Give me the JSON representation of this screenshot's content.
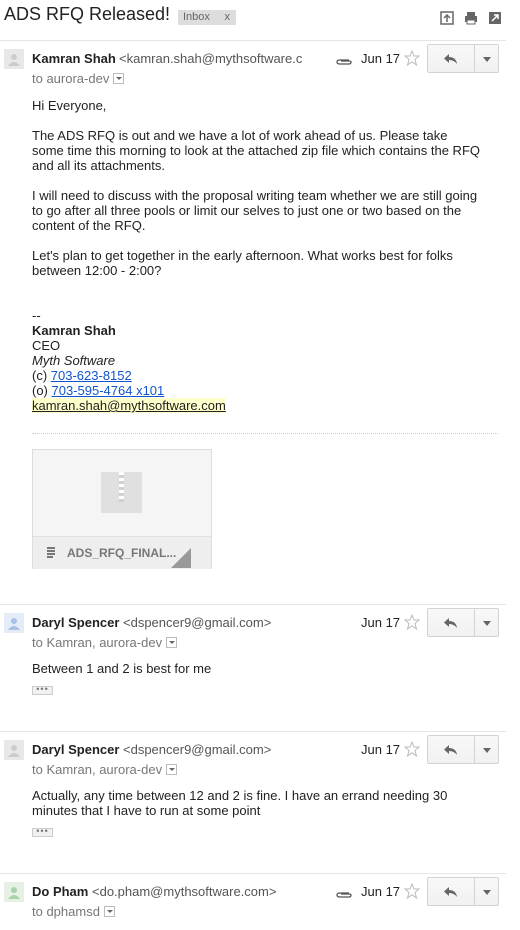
{
  "thread": {
    "subject": "ADS RFQ Released!",
    "label": "Inbox",
    "label_remove": "x"
  },
  "messages": [
    {
      "sender": "Kamran Shah",
      "email": "<kamran.shah@mythsoftware.com>",
      "to": "to aurora-dev",
      "date": "Jun 17",
      "has_attachment": true,
      "body": {
        "greeting": "Hi Everyone,",
        "p1": "The ADS RFQ is out and we have a lot of work ahead of us.  Please take some time this morning to look at the attached zip file which contains the RFQ and all its attachments.",
        "p2": "I will need to discuss with the proposal writing team whether we are still going to go after all three pools or limit our selves to just one or two based on the content of the RFQ.",
        "p3": "Let's plan to get together in the early afternoon.  What works best for folks between 12:00 - 2:00?",
        "sig_dash": "--",
        "sig_name": "Kamran Shah",
        "sig_title": "CEO",
        "sig_company": "Myth Software",
        "sig_cell_prefix": "(c) ",
        "sig_cell": "703-623-8152",
        "sig_office_prefix": "(o) ",
        "sig_office": "703-595-4764 x101",
        "sig_email": "kamran.shah@mythsoftware.com"
      },
      "attachment_name": "ADS_RFQ_FINAL..."
    },
    {
      "sender": "Daryl Spencer",
      "email": "<dspencer9@gmail.com>",
      "to": "to Kamran, aurora-dev",
      "date": "Jun 17",
      "body": "Between 1 and 2 is best for me",
      "ellipsis": "•••"
    },
    {
      "sender": "Daryl Spencer",
      "email": "<dspencer9@gmail.com>",
      "to": "to Kamran, aurora-dev",
      "date": "Jun 17",
      "body": "Actually, any time between 12 and 2 is fine. I have an errand needing 30 minutes that I have to run at some point",
      "ellipsis": "•••"
    },
    {
      "sender": "Do Pham",
      "email": "<do.pham@mythsoftware.com>",
      "to": "to dphamsd",
      "date": "Jun 17",
      "has_attachment": true
    }
  ],
  "colors": {
    "link": "#1155cc",
    "highlight": "#ffffcc",
    "label_bg": "#dddddd"
  }
}
